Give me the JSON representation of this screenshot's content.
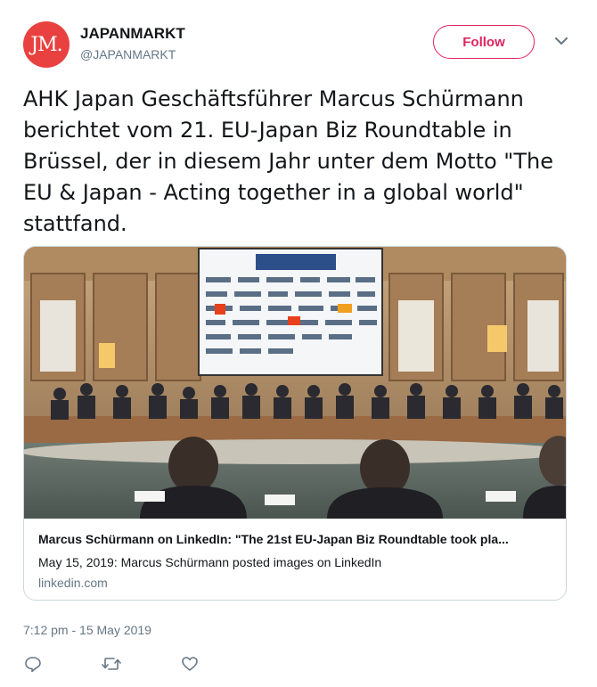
{
  "account": {
    "avatar_text": "JM.",
    "name": "JAPANMARKT",
    "handle": "@JAPANMARKT",
    "follow_label": "Follow",
    "brand_color": "#e8413f",
    "follow_color": "#e0245e"
  },
  "tweet": {
    "text": "AHK Japan Geschäftsführer Marcus Schürmann berichtet vom 21. EU-Japan Biz Roundtable in Brüssel, der in diesem Jahr unter dem Motto \"The EU & Japan - Acting together in a global world\" stattfand.",
    "timestamp": "7:12 pm - 15 May 2019"
  },
  "card": {
    "title": "Marcus Schürmann on LinkedIn: \"The 21st EU-Japan Biz Roundtable took pla...",
    "description": "May 15, 2019: Marcus Schürmann posted images on LinkedIn",
    "domain": "linkedin.com",
    "screen_header": "EU-Japan Business Round Table",
    "sponsor_logos": [
      "AIRBUS",
      "ANA",
      "Bayer",
      "ESF",
      "JT",
      "LEGO",
      "NEC",
      "NTT",
      "NISSAN",
      "NOMURA",
      "PHILIPS",
      "TOSHIBA",
      "Panasonic",
      "MITSUBISHI",
      "Mizuho",
      "DAIMLER"
    ]
  },
  "actions": [
    {
      "name": "reply-icon"
    },
    {
      "name": "retweet-icon"
    },
    {
      "name": "like-icon"
    }
  ]
}
